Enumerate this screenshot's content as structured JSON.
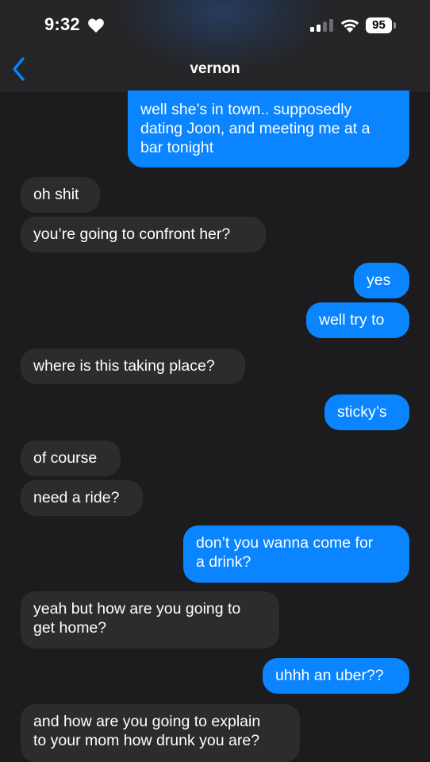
{
  "status_bar": {
    "time": "9:32",
    "battery": "95",
    "icons": [
      "heart-icon",
      "cellular-signal-icon",
      "wifi-icon",
      "battery-icon"
    ]
  },
  "header": {
    "back_icon": "chevron-left-icon",
    "contact_name": "vernon"
  },
  "colors": {
    "outgoing_bubble": "#0a84ff",
    "incoming_bubble": "#2c2c2e",
    "background": "#1c1c1e",
    "accent": "#0a84ff"
  },
  "messages": [
    {
      "direction": "outgoing",
      "text": "well she’s in town.. supposedly\ndating Joon, and meeting me at a\nbar tonight"
    },
    {
      "direction": "incoming",
      "text": "oh shit"
    },
    {
      "direction": "incoming",
      "text": "you’re going to confront her?"
    },
    {
      "direction": "outgoing",
      "text": "yes"
    },
    {
      "direction": "outgoing",
      "text": "well try to"
    },
    {
      "direction": "incoming",
      "text": "where is this taking place?"
    },
    {
      "direction": "outgoing",
      "text": "sticky’s"
    },
    {
      "direction": "incoming",
      "text": "of course"
    },
    {
      "direction": "incoming",
      "text": "need a ride?"
    },
    {
      "direction": "outgoing",
      "text": "don’t you wanna come for\na drink?"
    },
    {
      "direction": "incoming",
      "text": "yeah but how are you going to\nget home?"
    },
    {
      "direction": "outgoing",
      "text": "uhhh an uber??"
    },
    {
      "direction": "incoming",
      "text": "and how are you going to explain\nto your mom how drunk you are?"
    }
  ]
}
